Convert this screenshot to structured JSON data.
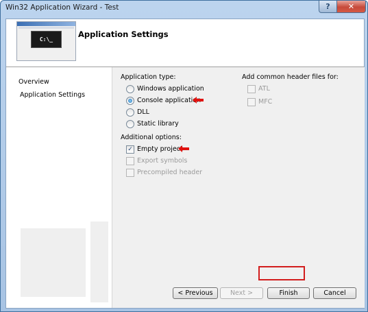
{
  "window": {
    "title": "Win32 Application Wizard - Test",
    "help_glyph": "?",
    "close_glyph": "✕"
  },
  "header": {
    "title": "Application Settings",
    "thumbnail_text": "C:\\_"
  },
  "nav": {
    "items": [
      {
        "label": "Overview"
      },
      {
        "label": "Application Settings"
      }
    ]
  },
  "app_type": {
    "label": "Application type:",
    "options": [
      {
        "label": "Windows application",
        "checked": false
      },
      {
        "label": "Console application",
        "checked": true
      },
      {
        "label": "DLL",
        "checked": false
      },
      {
        "label": "Static library",
        "checked": false
      }
    ]
  },
  "additional": {
    "label": "Additional options:",
    "options": [
      {
        "label": "Empty project",
        "checked": true,
        "enabled": true
      },
      {
        "label": "Export symbols",
        "checked": false,
        "enabled": false
      },
      {
        "label": "Precompiled header",
        "checked": false,
        "enabled": false
      }
    ]
  },
  "headers": {
    "label": "Add common header files for:",
    "options": [
      {
        "label": "ATL",
        "checked": false,
        "enabled": false
      },
      {
        "label": "MFC",
        "checked": false,
        "enabled": false
      }
    ]
  },
  "buttons": {
    "previous": "< Previous",
    "next": "Next >",
    "finish": "Finish",
    "cancel": "Cancel"
  },
  "colors": {
    "annotation_arrow": "#e0120f",
    "finish_highlight": "#d21c1c"
  }
}
